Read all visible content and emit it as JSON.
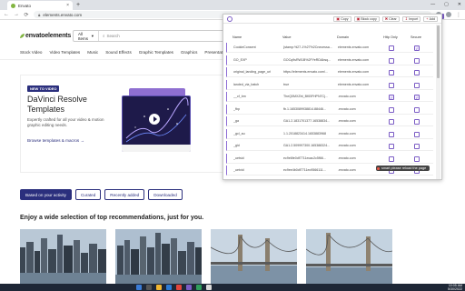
{
  "browser": {
    "tab_title": "Envato",
    "new_tab_symbol": "+",
    "close_symbol": "×",
    "window_controls": [
      "—",
      "▢",
      "✕"
    ],
    "url": "elements.envato.com"
  },
  "site": {
    "logo": "envatoelements",
    "search": {
      "category": "All Items",
      "placeholder": "Search"
    },
    "nav": [
      "Stock Video",
      "Video Templates",
      "Music",
      "Sound Effects",
      "Graphic Templates",
      "Graphics",
      "Presentation T"
    ],
    "promo": {
      "badge": "NEW TO VIDEO",
      "title": "DaVinci Resolve Templates",
      "description": "Expertly crafted for all your video & motion graphic editing needs.",
      "link": "Browse templates & macros →"
    },
    "filters": [
      {
        "label": "Based on your activity",
        "active": true
      },
      {
        "label": "Curated",
        "active": false
      },
      {
        "label": "Recently added",
        "active": false
      },
      {
        "label": "Downloaded",
        "active": false
      }
    ],
    "heading": "Enjoy a wide selection of top recommendations, just for you."
  },
  "cookie_panel": {
    "buttons": [
      "Copy",
      "Block copy",
      "Clear",
      "Import",
      "Add"
    ],
    "columns": {
      "name": "Name",
      "value": "Value",
      "domain": "Domain",
      "http_only": "Http Only",
      "secure": "Secure"
    },
    "rows": [
      {
        "name": "CookieConsent",
        "value": "{stamp:%27-1%27%2Cnecessa...",
        "domain": "elements.envato.com",
        "http_only": false,
        "secure": true
      },
      {
        "name": "GO_EXP",
        "value": "GOCq9sRW1B%2FYeRDAbsq...",
        "domain": "elements.envato.com",
        "http_only": false,
        "secure": false
      },
      {
        "name": "original_landing_page_url",
        "value": "https://elements.envato.com/...",
        "domain": "elements.envato.com",
        "http_only": false,
        "secure": false
      },
      {
        "name": "landed_via_batch",
        "value": "true",
        "domain": "elements.envato.com",
        "http_only": false,
        "secure": false
      },
      {
        "name": "__cf_bm",
        "value": "TheQ0MXZbt_BKBFHPN7Cj...",
        "domain": ".envato.com",
        "http_only": true,
        "secure": true
      },
      {
        "name": "_fbp",
        "value": "fb.1.1653089938814.88446...",
        "domain": ".envato.com",
        "http_only": false,
        "secure": false
      },
      {
        "name": "_ga",
        "value": "GA1.2.1831701377.16538834...",
        "domain": ".envato.com",
        "http_only": false,
        "secure": false
      },
      {
        "name": "_gcl_au",
        "value": "1.1.2018823414.1653883968",
        "domain": ".envato.com",
        "http_only": false,
        "secure": false
      },
      {
        "name": "_gid",
        "value": "GA1.2.509997300.165388324...",
        "domain": ".envato.com",
        "http_only": false,
        "secure": false
      },
      {
        "name": "_uetsid",
        "value": "ec9e6fe0df7711ecac2c5f66...",
        "domain": ".envato.com",
        "http_only": false,
        "secure": false
      },
      {
        "name": "_uetvid",
        "value": "ec9ee4b0df7711ec9566111...",
        "domain": ".envato.com",
        "http_only": false,
        "secure": false
      }
    ],
    "toast": "smart please reload the page"
  },
  "taskbar": {
    "time": "10:05 AM",
    "date": "5/30/2022"
  }
}
